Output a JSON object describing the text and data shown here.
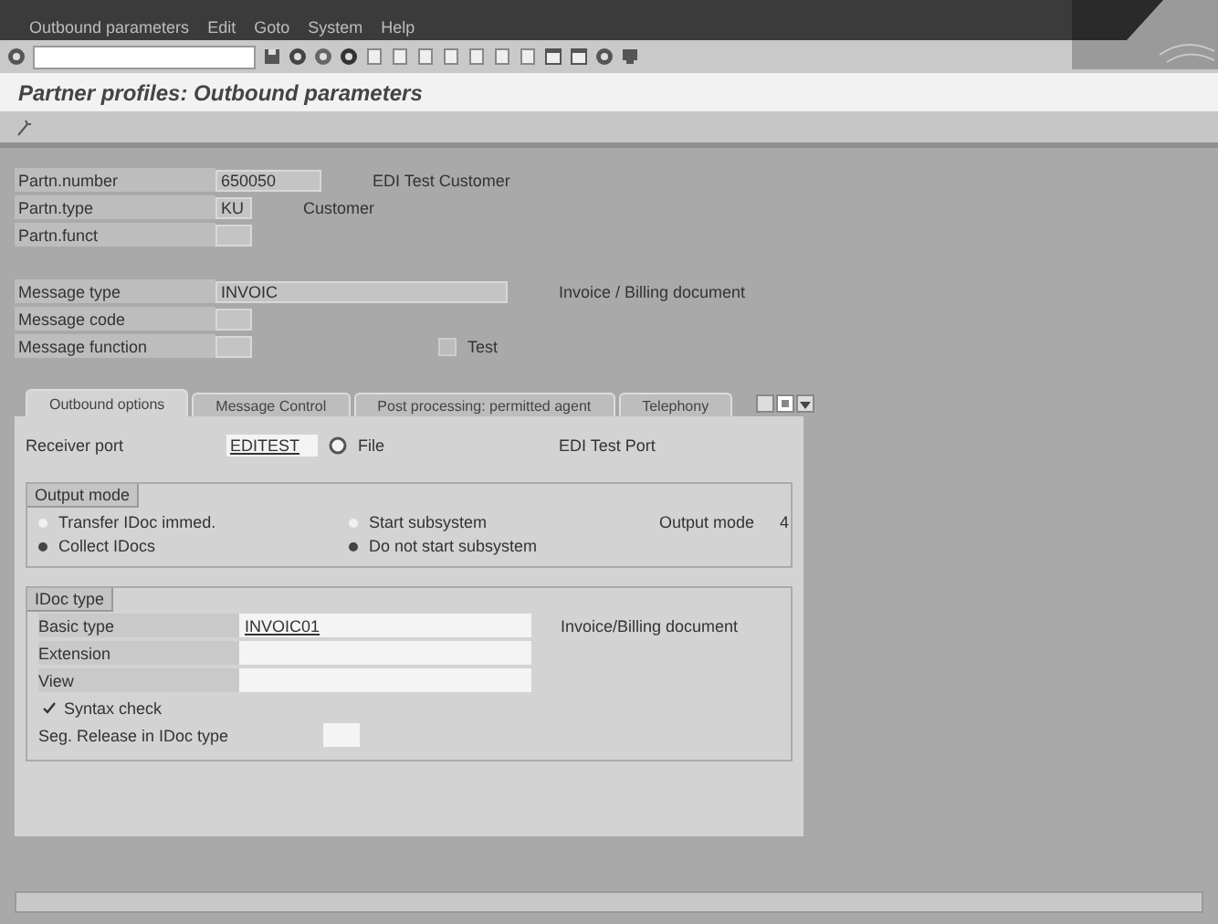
{
  "menu_bar": {
    "items": [
      "Outbound parameters",
      "Edit",
      "Goto",
      "System",
      "Help"
    ]
  },
  "title": "Partner profiles: Outbound parameters",
  "header_fields": [
    {
      "label": "Partn.number",
      "value": "650050",
      "description": "EDI Test Customer",
      "kind": "short"
    },
    {
      "label": "Partn.type",
      "value": "KU",
      "description": "Customer",
      "kind": "tiny"
    },
    {
      "label": "Partn.funct",
      "kind": "tiny"
    }
  ],
  "message_fields": [
    {
      "label": "Message type",
      "value": "INVOIC",
      "description": "Invoice / Billing document",
      "kind": "long"
    },
    {
      "label": "Message code",
      "kind": "tiny"
    },
    {
      "label": "Message function",
      "kind": "tiny"
    }
  ],
  "test_checkbox": {
    "label": "Test",
    "checked": false,
    "disabled": true
  },
  "tabs": [
    {
      "label": "Outbound options",
      "selected": true
    },
    {
      "label": "Message Control",
      "selected": false
    },
    {
      "label": "Post processing: permitted agent",
      "selected": false
    },
    {
      "label": "Telephony",
      "selected": false
    }
  ],
  "receiver_port": {
    "label": "Receiver port",
    "value": "EDITEST",
    "type": "File",
    "description": "EDI Test Port"
  },
  "output_mode": {
    "title": "Output mode",
    "transfer_options": [
      {
        "label": "Transfer IDoc immed.",
        "selected": false
      },
      {
        "label": "Collect IDocs",
        "selected": true
      }
    ],
    "subsystem_options": [
      {
        "label": "Start subsystem",
        "selected": false
      },
      {
        "label": "Do not start subsystem",
        "selected": true
      }
    ],
    "output_mode_label": "Output mode",
    "output_mode_value": "4"
  },
  "idoc_type": {
    "title": "IDoc type",
    "fields": [
      {
        "label": "Basic type",
        "value": "INVOIC01",
        "description": "Invoice/Billing document"
      },
      {
        "label": "Extension"
      },
      {
        "label": "View"
      }
    ],
    "syntax_check": {
      "label": "Syntax check",
      "checked": true
    },
    "seg_release_label": "Seg. Release in IDoc type"
  }
}
